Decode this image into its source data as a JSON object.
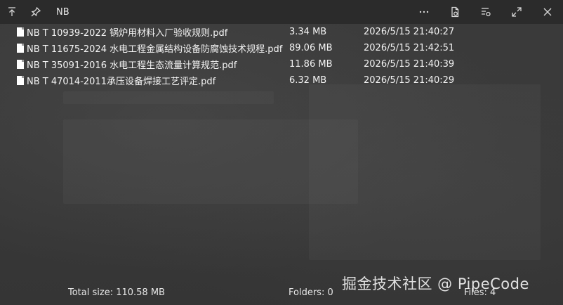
{
  "window": {
    "title": "NB"
  },
  "titlebar": {
    "left_icons": [
      "pin-top-icon",
      "pushpin-icon"
    ],
    "right_icons": [
      "more-icon",
      "open-file-icon",
      "filter-icon",
      "expand-icon",
      "close-icon"
    ]
  },
  "files": [
    {
      "name": "NB T 10939-2022 锅炉用材料入厂验收规则.pdf",
      "size": "3.34 MB",
      "modified": "2026/5/15 21:40:27"
    },
    {
      "name": "NB T 11675-2024 水电工程金属结构设备防腐蚀技术规程.pdf",
      "size": "89.06 MB",
      "modified": "2026/5/15 21:42:51"
    },
    {
      "name": "NB T 35091-2016 水电工程生态流量计算规范.pdf",
      "size": "11.86 MB",
      "modified": "2026/5/15 21:40:39"
    },
    {
      "name": "NB T 47014-2011承压设备焊接工艺评定.pdf",
      "size": "6.32 MB",
      "modified": "2026/5/15 21:40:29"
    }
  ],
  "status": {
    "total_size": "Total size: 110.58 MB",
    "folders": "Folders: 0",
    "files": "Files: 4"
  },
  "watermark": "掘金技术社区 @ PipeCode"
}
